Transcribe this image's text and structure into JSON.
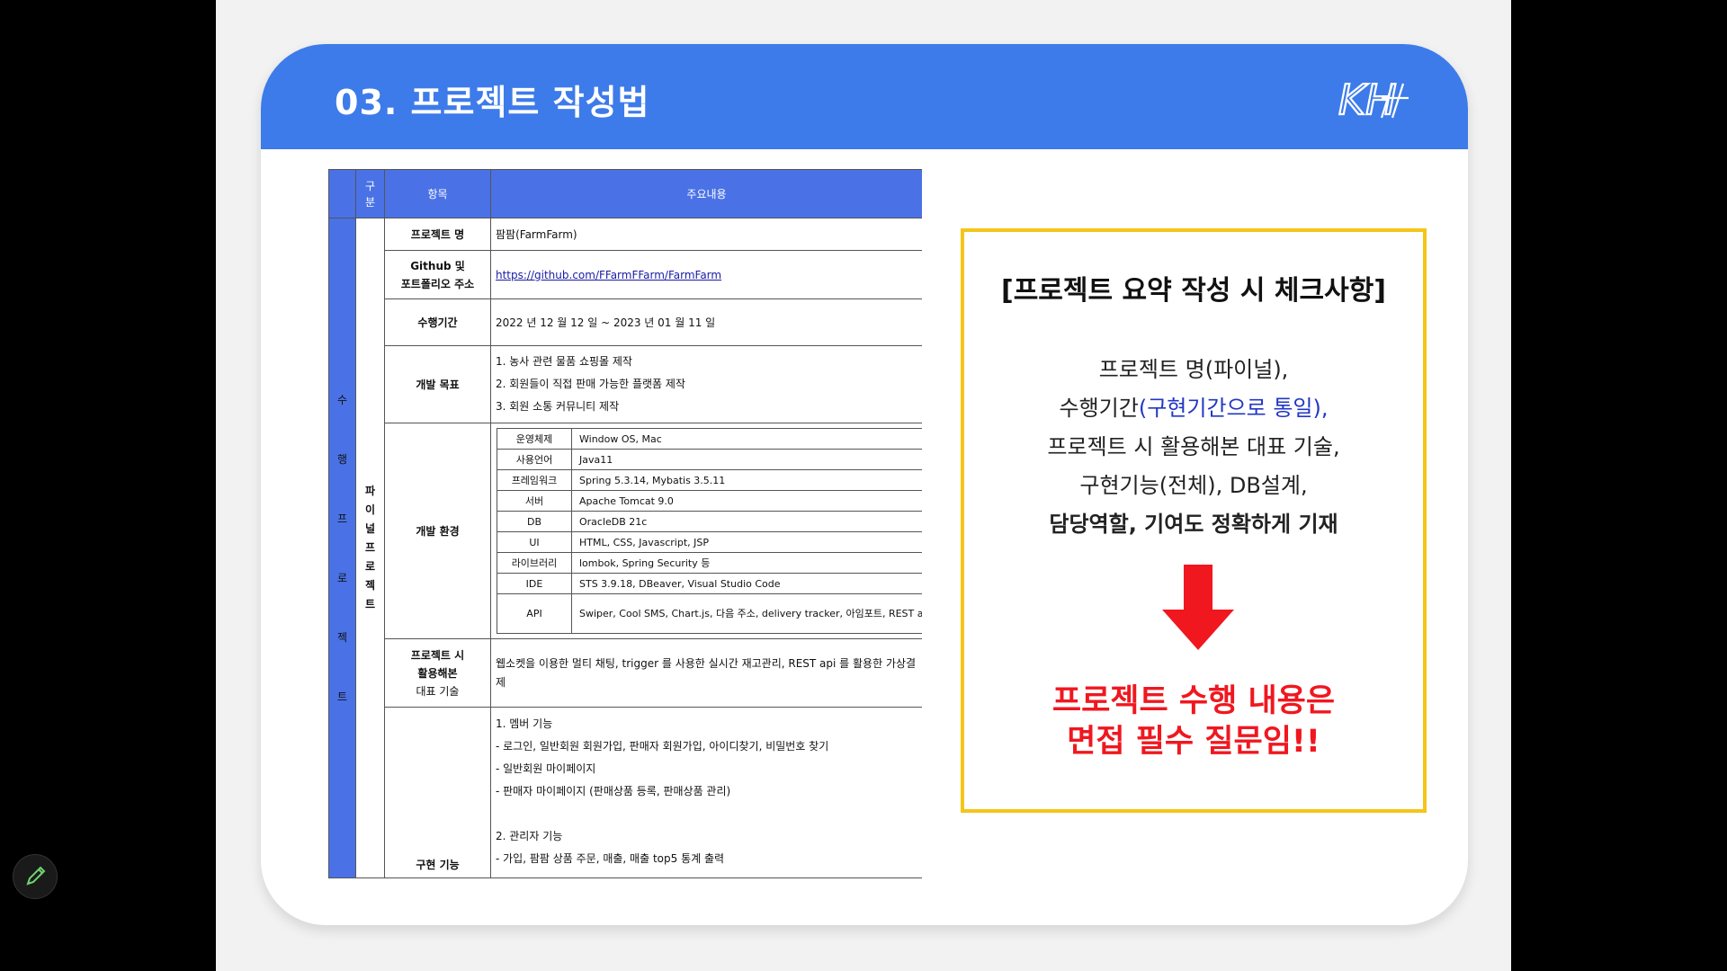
{
  "slide": {
    "title": "03. 프로젝트 작성법",
    "logo_text": "KH"
  },
  "doc": {
    "header": {
      "col1": "구\n분",
      "col2": "항목",
      "col3": "주요내용"
    },
    "side_label": "수 행 프 로 젝 트",
    "sub_label": "파 이 널 프 로 젝 트",
    "rows": {
      "name": {
        "item": "프로젝트 명",
        "value": "팜팜(FarmFarm)"
      },
      "github": {
        "item_line1": "Github 및",
        "item_line2": "포트폴리오 주소",
        "value": "https://github.com/FFarmFFarm/FarmFarm"
      },
      "period": {
        "item": "수행기간",
        "value": "2022 년 12 월 12 일 ~ 2023 년 01 월 11 일"
      },
      "goal": {
        "item": "개발 목표",
        "lines": [
          "1. 농사 관련 물품 쇼핑몰 제작",
          "2. 회원들이 직접 판매 가능한 플랫폼 제작",
          "3. 회원 소통 커뮤니티 제작"
        ]
      },
      "env": {
        "item": "개발 환경",
        "table": [
          {
            "k": "운영체제",
            "v": "Window OS, Mac"
          },
          {
            "k": "사용언어",
            "v": "Java11"
          },
          {
            "k": "프레임워크",
            "v": "Spring 5.3.14, Mybatis 3.5.11"
          },
          {
            "k": "서버",
            "v": "Apache Tomcat 9.0"
          },
          {
            "k": "DB",
            "v": "OracleDB 21c"
          },
          {
            "k": "UI",
            "v": "HTML, CSS, Javascript, JSP"
          },
          {
            "k": "라이브러리",
            "v": "lombok, Spring Security 등"
          },
          {
            "k": "IDE",
            "v": "STS 3.9.18, DBeaver, Visual Studio Code"
          },
          {
            "k": "API",
            "v": "Swiper, Cool SMS, Chart.js, 다음 주소, delivery tracker, 아임포트, REST api"
          }
        ]
      },
      "tech": {
        "item_line1": "프로젝트 시",
        "item_line2": "활용해본",
        "item_line3": "대표 기술",
        "value": "웹소켓을 이용한 멀티 채팅, trigger 를 사용한 실시간 재고관리, REST api 를 활용한 가상결제"
      },
      "impl": {
        "item": "구현 기능",
        "lines": [
          "1. 멤버 기능",
          " - 로그인, 일반회원 회원가입, 판매자 회원가입, 아이디찾기, 비밀번호 찾기",
          " - 일반회원 마이페이지",
          " - 판매자 마이페이지 (판매상품 등록, 판매상품 관리)",
          "",
          "2. 관리자 기능",
          " - 가입, 팜팜 상품 주문, 매출, 매출 top5 통계 출력"
        ]
      }
    }
  },
  "callout": {
    "heading": "[프로젝트 요약 작성 시 체크사항]",
    "line1": "프로젝트 명(파이널),",
    "line2_a": "수행기간",
    "line2_b": "(구현기간으로 통일),",
    "line3": "프로젝트 시 활용해본 대표 기술,",
    "line4": "구현기능(전체), DB설계,",
    "line5": "담당역할, 기여도 정확하게 기재",
    "warning_line1": "프로젝트 수행 내용은",
    "warning_line2": "면접 필수 질문임!!"
  },
  "colors": {
    "header_blue": "#3d7bea",
    "table_blue": "#4a72e6",
    "accent_red": "#f0171f",
    "callout_border": "#f5c518"
  },
  "icons": {
    "pen": "pencil-icon",
    "arrow": "down-arrow-icon"
  }
}
